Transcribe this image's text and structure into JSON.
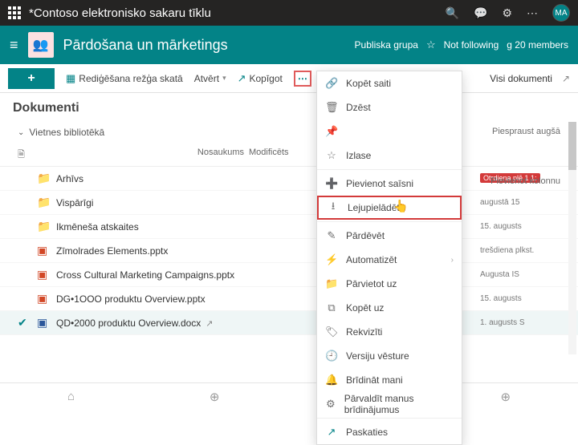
{
  "suite": {
    "title": "*Contoso elektronisko sakaru tīklu",
    "avatar": "MA"
  },
  "site": {
    "title": "Pārdošana un mārketings",
    "group_type": "Publiska grupa",
    "follow": "Not following",
    "members": "g 20 members"
  },
  "cmd": {
    "edit_grid": "Rediģēšana režģa skatā",
    "open": "Atvērt",
    "share": "Kopīgot",
    "view": "Visi dokumenti"
  },
  "library": {
    "title": "Dokumenti",
    "subtitle": "Vietnes bibliotēkā",
    "pin": "Piespraust augšā",
    "addcol": "Pievienot kolonnu"
  },
  "cols": {
    "name": "Nosaukums",
    "modified": "Modificēts"
  },
  "files": [
    {
      "icon": "folder",
      "name": "Arhīvs",
      "mod_badge": "Otrdiena plē 1 1:"
    },
    {
      "icon": "folder",
      "name": "Vispārīgi",
      "mod": "augustā   15"
    },
    {
      "icon": "folder",
      "name": "Ikmēneša atskaites",
      "mod": "15. augusts"
    },
    {
      "icon": "pptx",
      "name": "Zīmolrades Elements.pptx",
      "mod": "trešdiena plkst."
    },
    {
      "icon": "pptx",
      "name": "Cross Cultural Marketing Campaigns.pptx",
      "mod": "Augusta IS"
    },
    {
      "icon": "pptx",
      "name": "DG•1OOO produktu Overview.pptx",
      "mod": "15. augusts"
    },
    {
      "icon": "docx",
      "name": "QD•2000 produktu Overview.docx",
      "mod": "1. augusts S",
      "selected": true
    }
  ],
  "menu": {
    "copy_link": "Kopēt saiti",
    "delete": "Dzēst",
    "pin": "",
    "favorite": "Izlase",
    "add_shortcut": "Pievienot saīsni",
    "download": "Lejupielādēt",
    "rename": "Pārdēvēt",
    "automate": "Automatizēt",
    "move_to": "Pārvietot uz",
    "copy_to": "Kopēt uz",
    "properties": "Rekvizīti",
    "version_history": "Versiju vēsture",
    "alert_me": "Brīdināt mani",
    "manage_alerts": "Pārvaldīt manus brīdinājumus",
    "preview": "Paskaties"
  }
}
